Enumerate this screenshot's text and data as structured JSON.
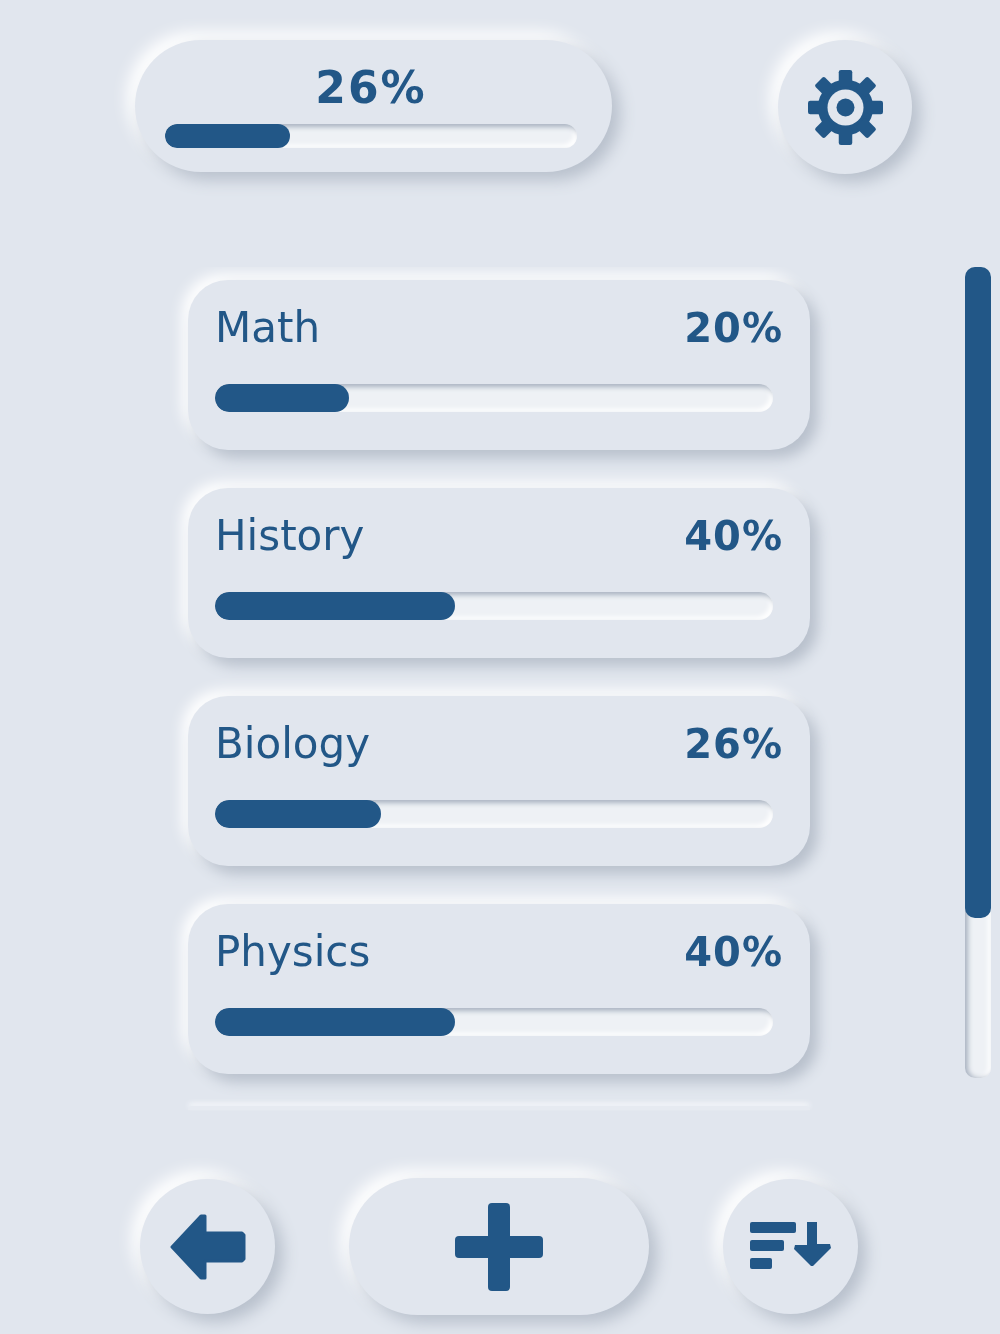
{
  "overall": {
    "value": "26%",
    "level": 0.26
  },
  "subjects": [
    {
      "name": "Math",
      "value": "20%",
      "level": 0.2
    },
    {
      "name": "History",
      "value": "40%",
      "level": 0.4
    },
    {
      "name": "Biology",
      "value": "26%",
      "level": 0.26
    },
    {
      "name": "Physics",
      "value": "40%",
      "level": 0.4
    }
  ]
}
